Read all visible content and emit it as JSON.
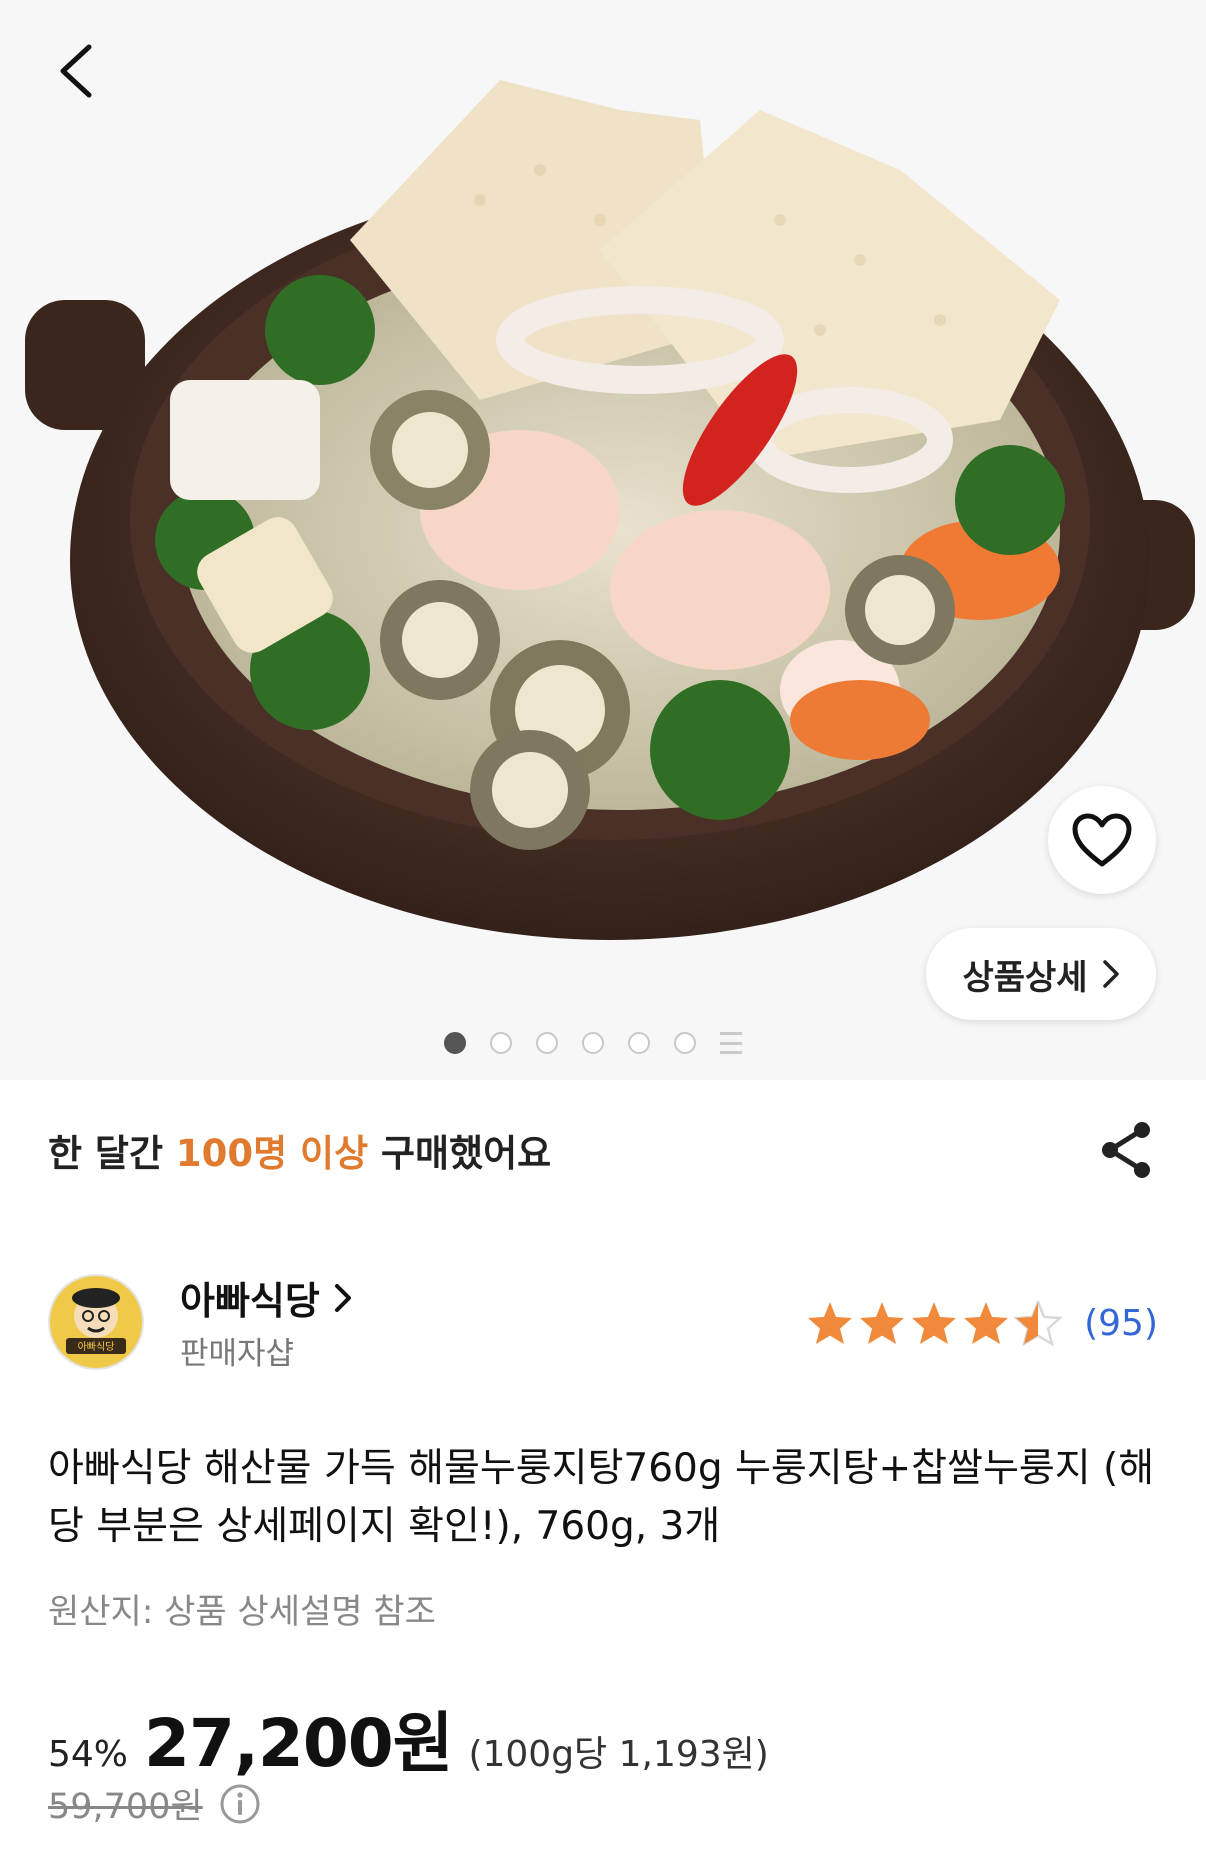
{
  "hero": {
    "wish_icon": "heart-outline-icon",
    "detail_label": "상품상세",
    "slide_count": 6,
    "active_slide": 1
  },
  "purchase": {
    "prefix": "한 달간 ",
    "highlight": "100명 이상",
    "suffix": " 구매했어요",
    "highlight_color": "#e07a2e"
  },
  "seller": {
    "logo_text": "아빠식당",
    "name": "아빠식당",
    "sub": "판매자샵",
    "rating": 4.5,
    "review_count": "(95)",
    "star_color": "#f0893a",
    "link_color": "#3467d6"
  },
  "product": {
    "title": "아빠식당 해산물 가득 해물누룽지탕760g 누룽지탕+찹쌀누룽지 (해당 부분은 상세페이지 확인!), 760g, 3개",
    "origin": "원산지: 상품 상세설명 참조"
  },
  "price": {
    "discount": "54%",
    "price": "27,200원",
    "unit_price": "(100g당 1,193원)",
    "original": "59,700원"
  }
}
